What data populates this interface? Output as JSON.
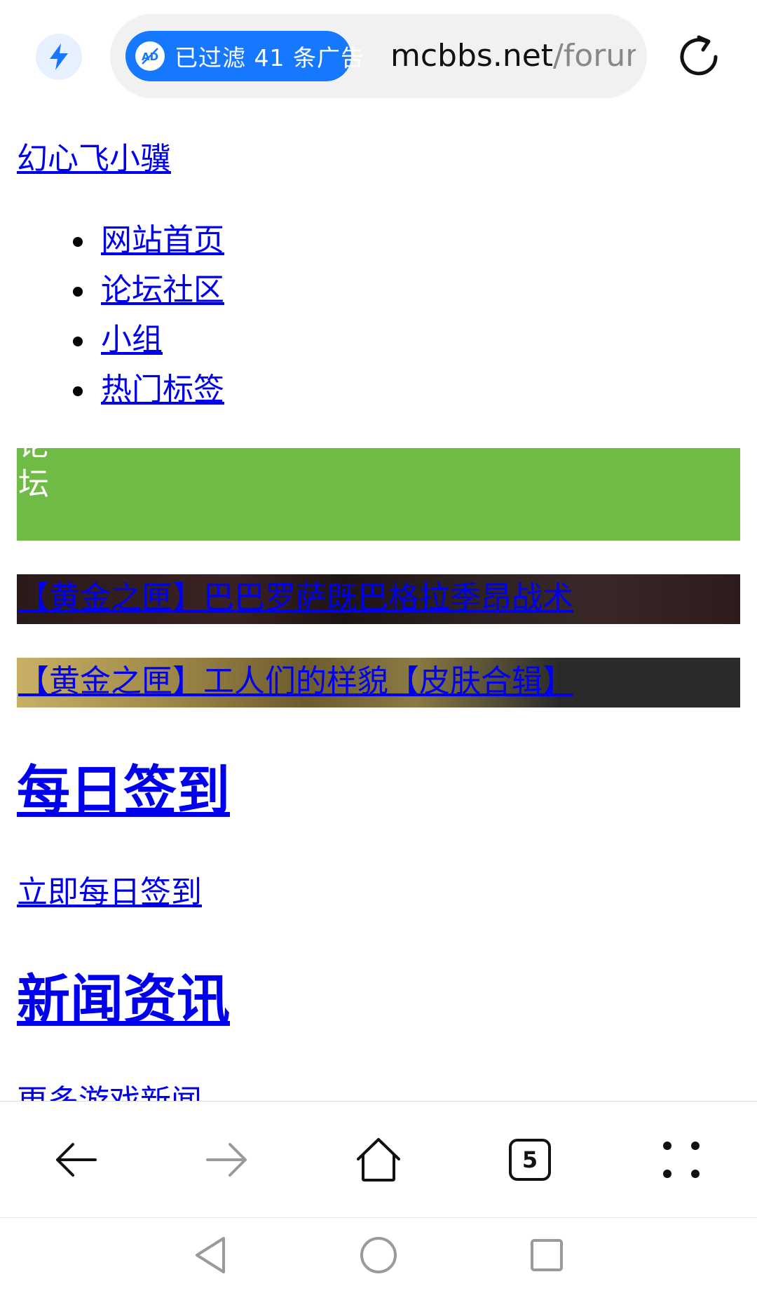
{
  "browser": {
    "ad_filter_label": "已过滤 41 条广告",
    "url_domain": "mcbbs.net",
    "url_path": "/forum",
    "open_tabs_count": "5",
    "accent_color": "#1677ff"
  },
  "page": {
    "site_link": "幻心飞小骥",
    "nav": [
      {
        "label": "网站首页"
      },
      {
        "label": "论坛社区"
      },
      {
        "label": "小组"
      },
      {
        "label": "热门标签"
      }
    ],
    "forum_banner_text": "论坛",
    "forum_banner_color": "#6fbb46",
    "featured": [
      {
        "title": "【黄金之匣】巴巴罗萨既巴格拉季昂战术"
      },
      {
        "title": "【黄金之匣】工人们的样貌【皮肤合辑】"
      }
    ],
    "daily_signin": {
      "heading": "每日签到",
      "link": "立即每日签到"
    },
    "news": {
      "heading": "新闻资讯",
      "more_link": "更多游戏新闻"
    }
  },
  "icons": {
    "bolt": "lightning-bolt-icon",
    "ad_block": "ad-block-icon",
    "reload": "reload-icon",
    "back": "arrow-left-icon",
    "forward": "arrow-right-icon",
    "home": "home-icon",
    "tabs": "tabs-icon",
    "menu": "more-dots-icon",
    "sys_back": "triangle-back-icon",
    "sys_home": "circle-home-icon",
    "sys_recents": "square-recents-icon"
  }
}
